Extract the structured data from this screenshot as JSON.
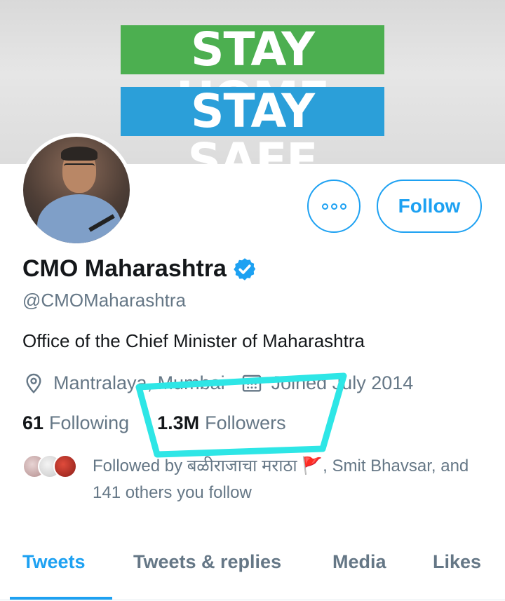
{
  "banner": {
    "line1": "STAY HOME",
    "line2": "STAY SAFE",
    "colors": {
      "line1_bg": "#4caf50",
      "line2_bg": "#2b9fd9"
    }
  },
  "profile": {
    "avatar_icon": "profile-photo",
    "more_icon": "more-dots-icon",
    "follow_label": "Follow",
    "name": "CMO Maharashtra",
    "verified_icon": "verified-badge-icon",
    "handle": "@CMOMaharashtra",
    "bio": "Office of the Chief Minister of Maharashtra",
    "location": "Mantralaya, Mumbai",
    "location_icon": "location-pin-icon",
    "joined": "Joined July 2014",
    "joined_icon": "calendar-icon",
    "following_count": "61",
    "following_label": "Following",
    "followers_count": "1.3M",
    "followers_label": "Followers",
    "followed_by": "Followed by बळीराजाचा मराठा 🚩, Smit Bhavsar, and 141 others you follow"
  },
  "tabs": [
    {
      "label": "Tweets",
      "active": true
    },
    {
      "label": "Tweets & replies",
      "active": false
    },
    {
      "label": "Media",
      "active": false
    },
    {
      "label": "Likes",
      "active": false
    }
  ],
  "colors": {
    "accent": "#1da1f2",
    "secondary_text": "#657786",
    "annotation": "#2ee6e6"
  }
}
